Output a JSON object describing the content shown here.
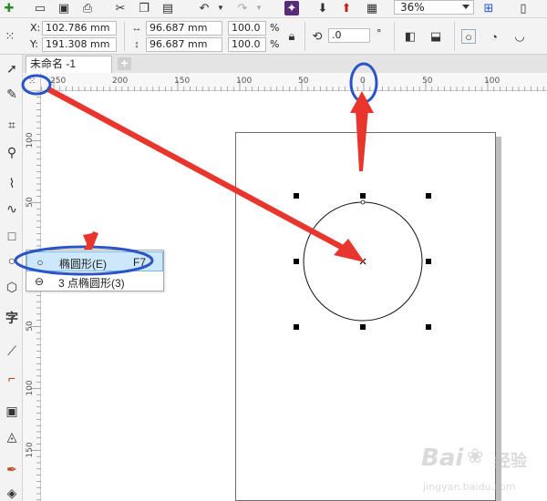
{
  "toolbar": {
    "zoom_value": "36%"
  },
  "propbar": {
    "x_label": "X:",
    "x_value": "102.786 mm",
    "y_label": "Y:",
    "y_value": "191.308 mm",
    "width_value": "96.687 mm",
    "height_value": "96.687 mm",
    "scale_x": "100.0",
    "scale_y": "100.0",
    "percent_symbol": "%",
    "rotation_value": ".0",
    "degree_symbol": "°"
  },
  "document": {
    "tab_title": "未命名 -1",
    "add_tab_symbol": "+"
  },
  "ruler_top": {
    "labels": [
      "250",
      "200",
      "150",
      "100",
      "50",
      "0",
      "50",
      "100"
    ]
  },
  "ruler_left": {
    "labels": [
      "100",
      "50",
      "0",
      "50",
      "100",
      "150"
    ]
  },
  "flyout": {
    "items": [
      {
        "label": "椭圆形(E)",
        "shortcut": "F7",
        "selected": true,
        "icon": "ellipse-icon"
      },
      {
        "label": "3 点椭圆形(3)",
        "shortcut": "",
        "selected": false,
        "icon": "three-point-ellipse-icon"
      }
    ]
  },
  "toolbox": {
    "text_tool_glyph": "字"
  },
  "watermark": {
    "brand": "Bai",
    "brand2": "经验",
    "url": "jingyan.baidu.com"
  },
  "colors": {
    "annotation_red": "#e8362f",
    "annotation_blue": "#2a55c8",
    "selection_blue": "#cde8fb"
  }
}
